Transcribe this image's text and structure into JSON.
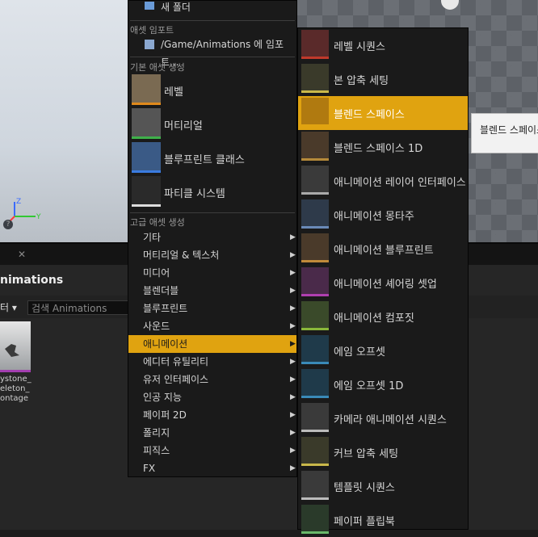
{
  "content_browser": {
    "title": "nimations",
    "filter_label": "터 ▾",
    "search_placeholder": "검색 Animations",
    "asset_label_lines": [
      "ystone_",
      "eleton_",
      "ontage"
    ]
  },
  "viewport": {
    "gizmo_axes": [
      "Z",
      "Y"
    ]
  },
  "menu1": {
    "new_folder": "새 폴더",
    "import_section": "애셋 임포트",
    "import_item": "/Game/Animations 에 임포트...",
    "basic_section": "기본 애셋 생성",
    "basic_items": [
      "레벨",
      "머티리얼",
      "블루프린트 클래스",
      "파티클 시스템"
    ],
    "advanced_section": "고급 애셋 생성",
    "advanced_items": [
      "기타",
      "머티리얼 & 텍스처",
      "미디어",
      "블렌더블",
      "블루프린트",
      "사운드",
      "애니메이션",
      "에디터 유틸리티",
      "유저 인터페이스",
      "인공 지능",
      "페이퍼 2D",
      "폴리지",
      "피직스",
      "FX"
    ],
    "active_item": "애니메이션"
  },
  "menu2": {
    "items": [
      "레벨 시퀀스",
      "본 압축 세팅",
      "블렌드 스페이스",
      "블렌드 스페이스 1D",
      "애니메이션 레이어 인터페이스",
      "애니메이션 몽타주",
      "애니메이션 블루프린트",
      "애니메이션 셰어링 셋업",
      "애니메이션 컴포짓",
      "에임 오프셋",
      "에임 오프셋 1D",
      "카메라 애니메이션 시퀀스",
      "커브 압축 세팅",
      "템플릿 시퀀스",
      "페이퍼 플립북"
    ],
    "active_item": "블렌드 스페이스"
  },
  "tooltip": {
    "text": "블렌드 스페이스"
  },
  "colors": {
    "highlight": "#e0a310",
    "menu_bg": "#1a1a1a"
  }
}
